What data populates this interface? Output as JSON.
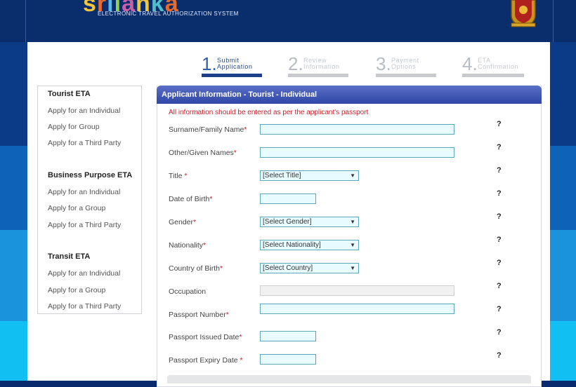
{
  "brand": {
    "logo_letters": [
      "s",
      "r",
      "i",
      "l",
      "a",
      "n",
      "k",
      "a"
    ],
    "system_title": "ELECTRONIC TRAVEL AUTHORIZATION SYSTEM"
  },
  "steps": [
    {
      "num": "1.",
      "line1": "Submit",
      "line2": "Application",
      "active": true
    },
    {
      "num": "2.",
      "line1": "Review",
      "line2": "Information",
      "active": false
    },
    {
      "num": "3.",
      "line1": "Payment",
      "line2": "Options",
      "active": false
    },
    {
      "num": "4.",
      "line1": "ETA",
      "line2": "Confirmation",
      "active": false
    }
  ],
  "sidebar": {
    "sections": [
      {
        "title": "Tourist ETA",
        "items": [
          "Apply for an Individual",
          "Apply for Group",
          "Apply for a Third Party"
        ]
      },
      {
        "title": "Business Purpose ETA",
        "items": [
          "Apply for an Individual",
          "Apply for a Group",
          "Apply for a Third Party"
        ]
      },
      {
        "title": "Transit ETA",
        "items": [
          "Apply for an Individual",
          "Apply for a Group",
          "Apply for a Third Party"
        ]
      }
    ]
  },
  "form": {
    "header": "Applicant Information - Tourist - Individual",
    "note": "All information should be entered as per the applicant's passport",
    "help_glyph": "?",
    "fields": {
      "surname": {
        "label": "Surname/Family Name",
        "req": "*"
      },
      "given": {
        "label": "Other/Given Names",
        "req": "*"
      },
      "title": {
        "label": "Title ",
        "req": "*",
        "selected": "[Select Title]"
      },
      "dob": {
        "label": "Date of Birth",
        "req": "*"
      },
      "gender": {
        "label": "Gender",
        "req": "*",
        "selected": "[Select Gender]"
      },
      "nationality": {
        "label": "Nationality",
        "req": "*",
        "selected": "[Select Nationality]"
      },
      "country": {
        "label": "Country of Birth",
        "req": "*",
        "selected": "[Select Country]"
      },
      "occupation": {
        "label": "Occupation",
        "req": ""
      },
      "passport": {
        "label": "Passport Number",
        "req": "*"
      },
      "issued": {
        "label": "Passport Issued Date",
        "req": "*"
      },
      "expiry": {
        "label": "Passport Expiry Date ",
        "req": "*"
      }
    }
  },
  "colors": {
    "accent": "#2f46a6",
    "required": "#c8202a",
    "input_bg": "#e8fbff"
  }
}
